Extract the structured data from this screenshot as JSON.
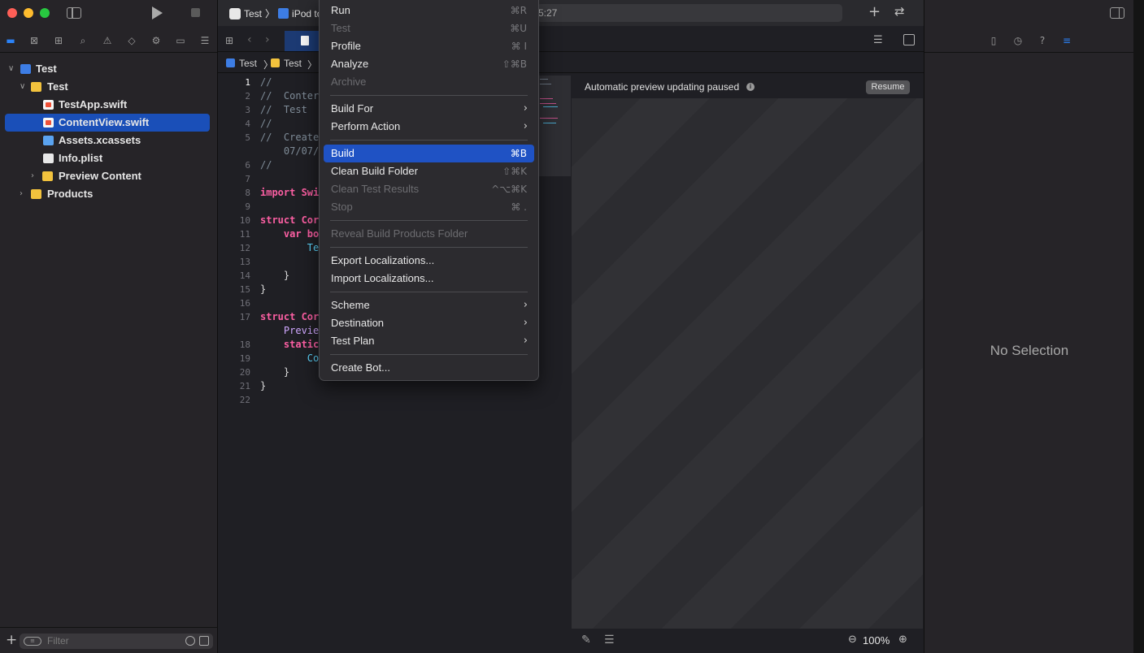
{
  "sidebar": {
    "nav_icons": [
      "folder-icon",
      "source-control-icon",
      "symbol-icon",
      "search-icon",
      "issue-icon",
      "test-icon",
      "debug-icon",
      "breakpoint-icon",
      "report-icon"
    ],
    "tree": [
      {
        "label": "Test",
        "kind": "project",
        "expanded": true
      },
      {
        "label": "Test",
        "kind": "folder",
        "expanded": true
      },
      {
        "label": "TestApp.swift",
        "kind": "swift"
      },
      {
        "label": "ContentView.swift",
        "kind": "swift",
        "selected": true
      },
      {
        "label": "Assets.xcassets",
        "kind": "assets"
      },
      {
        "label": "Info.plist",
        "kind": "plist"
      },
      {
        "label": "Preview Content",
        "kind": "folder",
        "expanded": false
      },
      {
        "label": "Products",
        "kind": "folder",
        "expanded": false
      }
    ],
    "filter_placeholder": "Filter"
  },
  "toolbar": {
    "scheme": "Test",
    "destination": "iPod to",
    "activity_text": "5:27"
  },
  "jumpbar": [
    "Test",
    "Test"
  ],
  "code": {
    "lines": [
      {
        "n": "1",
        "text": "//"
      },
      {
        "n": "2",
        "text": "//  Conter"
      },
      {
        "n": "3",
        "text": "//  Test"
      },
      {
        "n": "4",
        "text": "//"
      },
      {
        "n": "5",
        "text": "//  Create"
      },
      {
        "n": "",
        "text": "    07/07/"
      },
      {
        "n": "6",
        "text": "//"
      },
      {
        "n": "7",
        "text": ""
      },
      {
        "n": "8",
        "text": "import Swi"
      },
      {
        "n": "9",
        "text": ""
      },
      {
        "n": "10",
        "text": "struct Cor"
      },
      {
        "n": "11",
        "text": "    var bo"
      },
      {
        "n": "12",
        "text": "        Te"
      },
      {
        "n": "13",
        "text": ""
      },
      {
        "n": "14",
        "text": "    }"
      },
      {
        "n": "15",
        "text": "}"
      },
      {
        "n": "16",
        "text": ""
      },
      {
        "n": "17",
        "text": "struct Cor"
      },
      {
        "n": "",
        "text": "    Previe"
      },
      {
        "n": "18",
        "text": "    static"
      },
      {
        "n": "19",
        "text": "        Co"
      },
      {
        "n": "20",
        "text": "    }"
      },
      {
        "n": "21",
        "text": "}"
      },
      {
        "n": "22",
        "text": ""
      }
    ]
  },
  "canvas": {
    "status": "Automatic preview updating paused",
    "resume_label": "Resume",
    "zoom": "100%"
  },
  "inspector": {
    "empty_text": "No Selection"
  },
  "menu": {
    "items": [
      {
        "type": "item",
        "label": "Run",
        "shortcut": "⌘R"
      },
      {
        "type": "item",
        "label": "Test",
        "shortcut": "⌘U",
        "disabled": true
      },
      {
        "type": "item",
        "label": "Profile",
        "shortcut": "⌘ I"
      },
      {
        "type": "item",
        "label": "Analyze",
        "shortcut": "⇧⌘B"
      },
      {
        "type": "item",
        "label": "Archive",
        "shortcut": "",
        "disabled": true
      },
      {
        "type": "sep"
      },
      {
        "type": "item",
        "label": "Build For",
        "submenu": true
      },
      {
        "type": "item",
        "label": "Perform Action",
        "submenu": true
      },
      {
        "type": "sep"
      },
      {
        "type": "item",
        "label": "Build",
        "shortcut": "⌘B",
        "highlighted": true
      },
      {
        "type": "item",
        "label": "Clean Build Folder",
        "shortcut": "⇧⌘K"
      },
      {
        "type": "item",
        "label": "Clean Test Results",
        "shortcut": "^⌥⌘K",
        "disabled": true
      },
      {
        "type": "item",
        "label": "Stop",
        "shortcut": "⌘ .",
        "disabled": true
      },
      {
        "type": "sep"
      },
      {
        "type": "item",
        "label": "Reveal Build Products Folder",
        "disabled": true
      },
      {
        "type": "sep"
      },
      {
        "type": "item",
        "label": "Export Localizations..."
      },
      {
        "type": "item",
        "label": "Import Localizations..."
      },
      {
        "type": "sep"
      },
      {
        "type": "item",
        "label": "Scheme",
        "submenu": true
      },
      {
        "type": "item",
        "label": "Destination",
        "submenu": true
      },
      {
        "type": "item",
        "label": "Test Plan",
        "submenu": true
      },
      {
        "type": "sep"
      },
      {
        "type": "item",
        "label": "Create Bot..."
      }
    ]
  }
}
